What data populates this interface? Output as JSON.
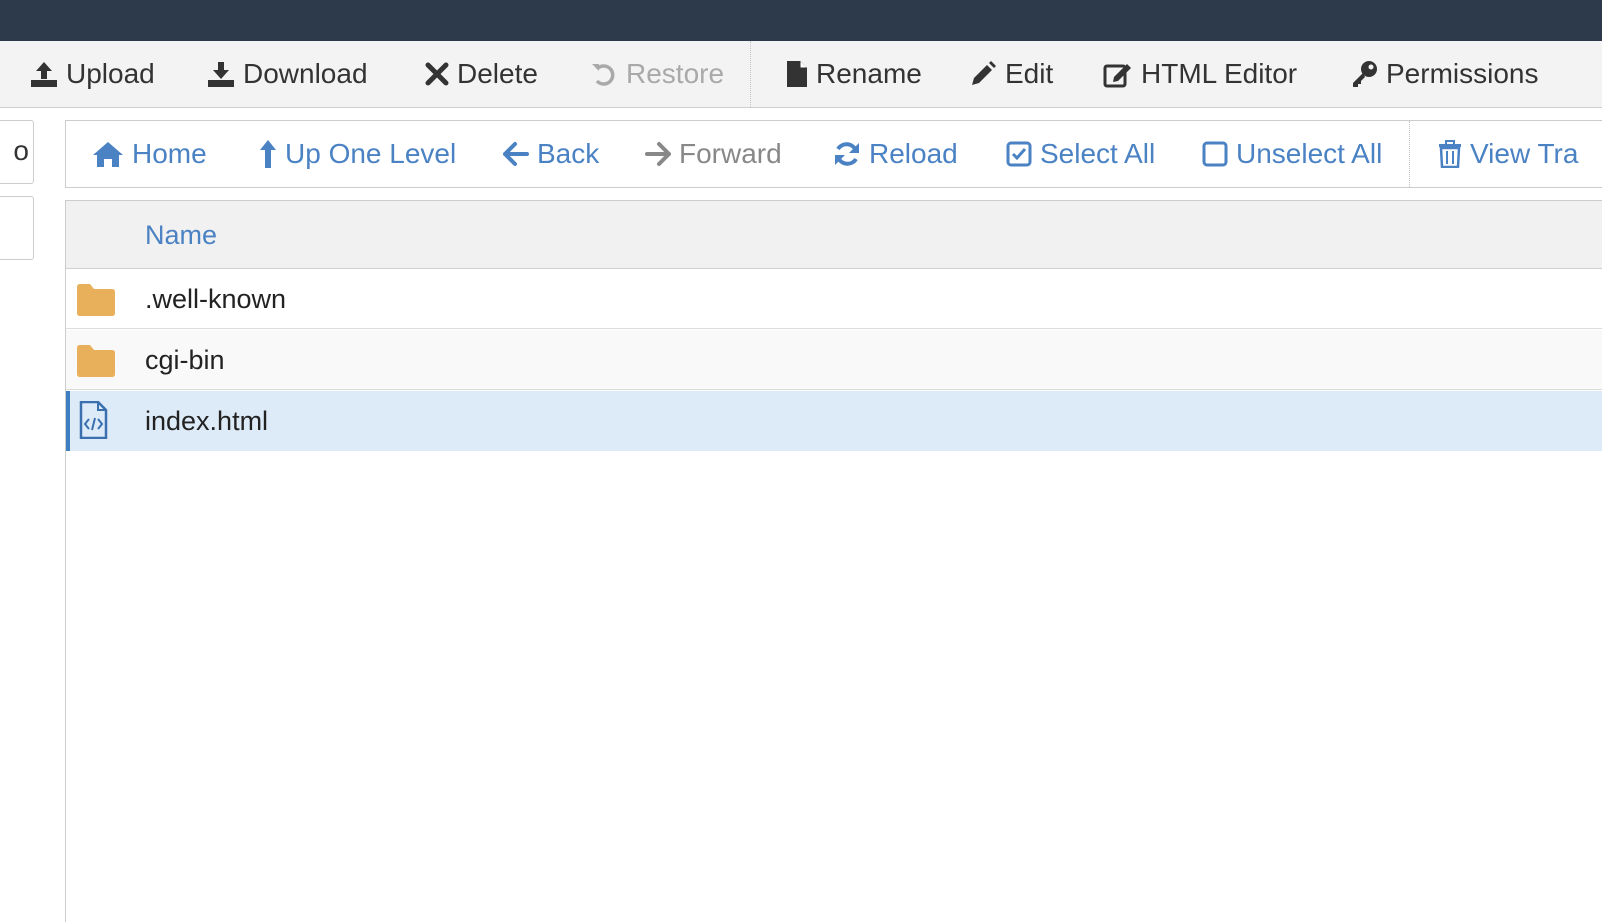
{
  "toolbar": {
    "upload": "Upload",
    "download": "Download",
    "delete": "Delete",
    "restore": "Restore",
    "rename": "Rename",
    "edit": "Edit",
    "html_editor": "HTML Editor",
    "permissions": "Permissions"
  },
  "left_panel": {
    "stub_glyph": "o"
  },
  "nav": {
    "home": "Home",
    "up_one_level": "Up One Level",
    "back": "Back",
    "forward": "Forward",
    "reload": "Reload",
    "select_all": "Select All",
    "unselect_all": "Unselect All",
    "view_trash": "View Tra"
  },
  "file_list": {
    "columns": {
      "name": "Name"
    },
    "rows": [
      {
        "name": ".well-known",
        "type": "folder-icon",
        "selected": false
      },
      {
        "name": "cgi-bin",
        "type": "folder-icon",
        "selected": false
      },
      {
        "name": "index.html",
        "type": "html-file-icon",
        "selected": true
      }
    ]
  },
  "colors": {
    "topbar": "#2d3a4b",
    "link_blue": "#4a82c3",
    "folder": "#e8b05a",
    "selected_row": "#ddeaf7",
    "selected_accent": "#3e7fc1"
  }
}
